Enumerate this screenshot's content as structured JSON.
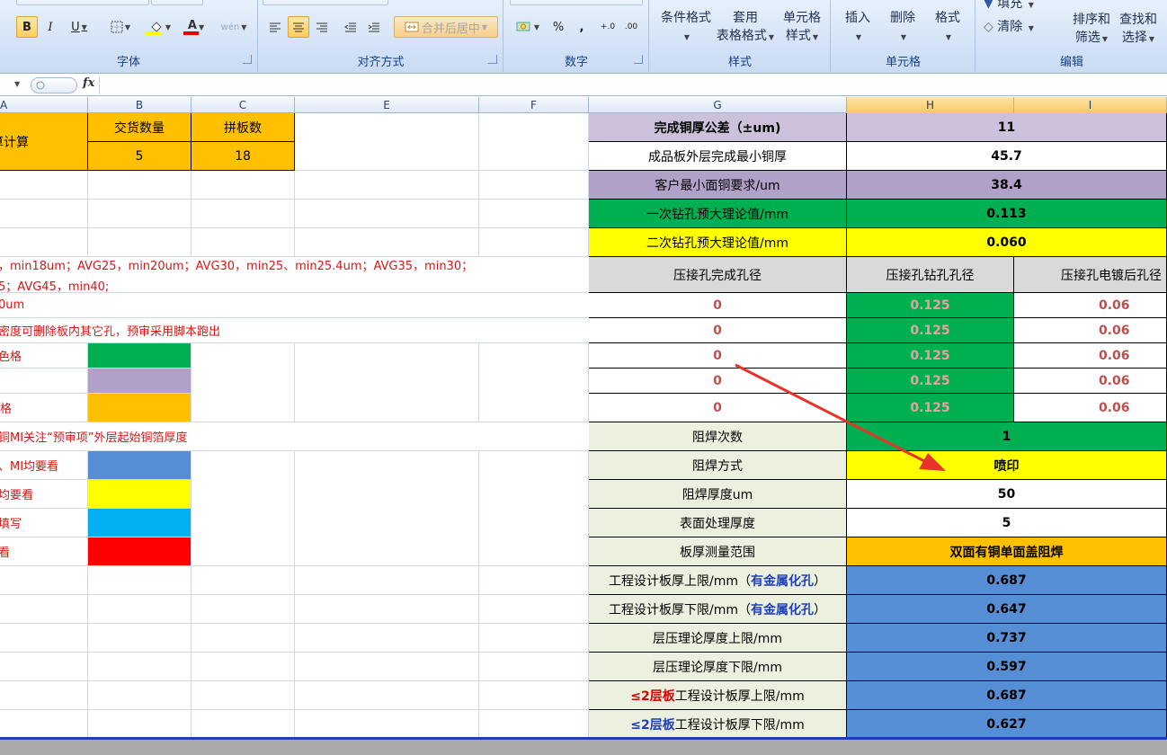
{
  "ribbon": {
    "groups": {
      "font": "字体",
      "alignment": "对齐方式",
      "number": "数字",
      "styles": "样式",
      "cells": "单元格",
      "editing": "编辑"
    },
    "font_buttons": {
      "bold": "B",
      "italic": "I",
      "underline": "U",
      "font_color": "A",
      "wen": "wén"
    },
    "merge_center": "合并后居中",
    "percent": "%",
    "comma": ",",
    "inc_decimal": "+.0",
    "dec_decimal": ".00",
    "conditional_format": [
      "条件格式",
      ""
    ],
    "table_format": [
      "套用",
      "表格格式"
    ],
    "cell_styles": [
      "单元格",
      "样式"
    ],
    "insert": "插入",
    "delete": "删除",
    "format": "格式",
    "fill": "填充",
    "clear": "清除",
    "sort_filter": [
      "排序和",
      "筛选"
    ],
    "find_select": [
      "查找和",
      "选择"
    ]
  },
  "formula_bar": {
    "fx": "fx",
    "value": ""
  },
  "columns": [
    "A",
    "B",
    "C",
    "E",
    "F",
    "G",
    "H",
    "I"
  ],
  "left": {
    "a1": "算计算",
    "b1": "交货数量",
    "c1": "拼板数",
    "b2": "5",
    "c2": "18",
    "note1": "，min18um；AVG25，min20um；AVG30，min25、min25.4um；AVG35，min30；",
    "note2": "5；AVG45，min40;",
    "note3": "0um",
    "note4": "密度可删除板内其它孔，预审采用脚本跑出",
    "note5": "色格",
    "note6": "格",
    "note7": "铜MI关注“预审项”外层起始铜箔厚度",
    "note8": "、MI均要看",
    "note9": "均要看",
    "note10": "填写",
    "note11": "看"
  },
  "right": {
    "r1": {
      "label": "完成铜厚公差（±um)",
      "value": "11"
    },
    "r2": {
      "label": "成品板外层完成最小铜厚",
      "value": "45.7"
    },
    "r3": {
      "label": "客户最小面铜要求/um",
      "value": "38.4"
    },
    "r4": {
      "label": "一次钻孔预大理论值/mm",
      "value": "0.113"
    },
    "r5": {
      "label": "二次钻孔预大理论值/mm",
      "value": "0.060"
    },
    "hole_headers": [
      "压接孔完成孔径",
      "压接孔钻孔孔径",
      "压接孔电镀后孔径"
    ],
    "hole_rows": [
      [
        "0",
        "0.125",
        "0.06"
      ],
      [
        "0",
        "0.125",
        "0.06"
      ],
      [
        "0",
        "0.125",
        "0.06"
      ],
      [
        "0",
        "0.125",
        "0.06"
      ],
      [
        "0",
        "0.125",
        "0.06"
      ]
    ],
    "r11": {
      "label": "阻焊次数",
      "value": "1"
    },
    "r12": {
      "label": "阻焊方式",
      "value": "喷印"
    },
    "r13": {
      "label": "阻焊厚度um",
      "value": "50"
    },
    "r14": {
      "label": "表面处理厚度",
      "value": "5"
    },
    "r15": {
      "label": "板厚测量范围",
      "value": "双面有铜单面盖阻焊"
    },
    "r16": {
      "label_pre": "工程设计板厚上限/mm（",
      "label_hl": "有金属化孔",
      "label_post": "）",
      "value": "0.687"
    },
    "r17": {
      "label_pre": "工程设计板厚下限/mm（",
      "label_hl": "有金属化孔",
      "label_post": "）",
      "value": "0.647"
    },
    "r18": {
      "label": "层压理论厚度上限/mm",
      "value": "0.737"
    },
    "r19": {
      "label": "层压理论厚度下限/mm",
      "value": "0.597"
    },
    "r20": {
      "label_hl": "≤2层板",
      "label_post": "工程设计板厚上限/mm",
      "value": "0.687"
    },
    "r21": {
      "label_hl": "≤2层板",
      "label_post": "工程设计板厚下限/mm",
      "value": "0.627"
    }
  },
  "colors": {
    "orange": "#ffc000",
    "lavender": "#ccc0da",
    "purple": "#b1a0c7",
    "green": "#00b050",
    "yellow": "#ffff00",
    "gray": "#d9d9d9",
    "sky": "#00b0f0",
    "red": "#ff0000",
    "steel": "#558ed5",
    "mint": "#ebf1de"
  }
}
